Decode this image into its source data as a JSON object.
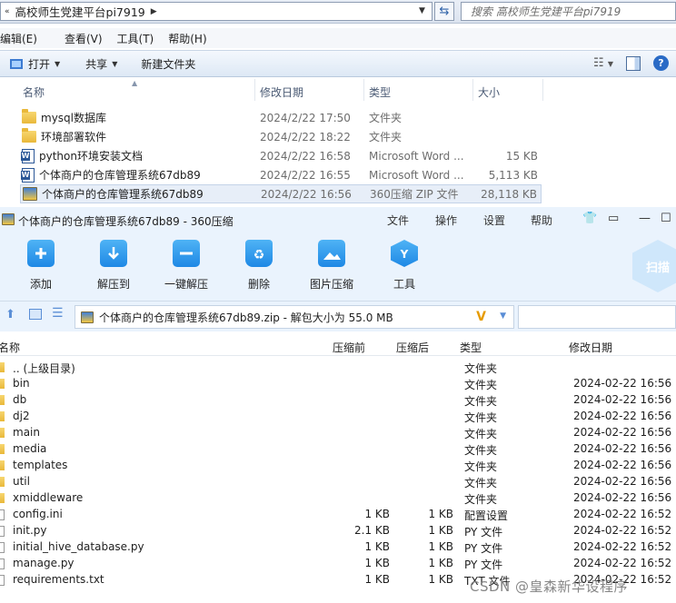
{
  "explorer": {
    "path_segment": "高校师生党建平台pi7919",
    "search_placeholder": "搜索 高校师生党建平台pi7919",
    "menu": [
      "编辑(E)",
      "查看(V)",
      "工具(T)",
      "帮助(H)"
    ],
    "toolbar": {
      "open": "打开",
      "share": "共享",
      "new_folder": "新建文件夹"
    },
    "columns": {
      "name": "名称",
      "date": "修改日期",
      "type": "类型",
      "size": "大小"
    },
    "files": [
      {
        "name": "mysql数据库",
        "date": "2024/2/22 17:50",
        "type": "文件夹",
        "size": "",
        "icon": "folder-icon"
      },
      {
        "name": "环境部署软件",
        "date": "2024/2/22 18:22",
        "type": "文件夹",
        "size": "",
        "icon": "folder-icon"
      },
      {
        "name": "python环境安装文档",
        "date": "2024/2/22 16:58",
        "type": "Microsoft Word ...",
        "size": "15 KB",
        "icon": "word-icon"
      },
      {
        "name": "个体商户的仓库管理系统67db89",
        "date": "2024/2/22 16:55",
        "type": "Microsoft Word ...",
        "size": "5,113 KB",
        "icon": "word-icon"
      },
      {
        "name": "个体商户的仓库管理系统67db89",
        "date": "2024/2/22 16:56",
        "type": "360压缩 ZIP 文件",
        "size": "28,118 KB",
        "icon": "zip-icon",
        "selected": true
      }
    ]
  },
  "zip": {
    "title": "个体商户的仓库管理系统67db89 - 360压缩",
    "menu": [
      "文件",
      "操作",
      "设置",
      "帮助"
    ],
    "ribbon": [
      "添加",
      "解压到",
      "一键解压",
      "删除",
      "图片压缩",
      "工具"
    ],
    "scan_label": "扫描",
    "path_text": "个体商户的仓库管理系统67db89.zip - 解包大小为 55.0 MB",
    "columns": {
      "name": "名称",
      "orig": "压缩前",
      "comp": "压缩后",
      "type": "类型",
      "date": "修改日期"
    },
    "rows": [
      {
        "name": ".. (上级目录)",
        "orig": "",
        "comp": "",
        "type": "文件夹",
        "date": "",
        "kind": "folder"
      },
      {
        "name": "bin",
        "orig": "",
        "comp": "",
        "type": "文件夹",
        "date": "2024-02-22 16:56",
        "kind": "folder"
      },
      {
        "name": "db",
        "orig": "",
        "comp": "",
        "type": "文件夹",
        "date": "2024-02-22 16:56",
        "kind": "folder"
      },
      {
        "name": "dj2",
        "orig": "",
        "comp": "",
        "type": "文件夹",
        "date": "2024-02-22 16:56",
        "kind": "folder"
      },
      {
        "name": "main",
        "orig": "",
        "comp": "",
        "type": "文件夹",
        "date": "2024-02-22 16:56",
        "kind": "folder"
      },
      {
        "name": "media",
        "orig": "",
        "comp": "",
        "type": "文件夹",
        "date": "2024-02-22 16:56",
        "kind": "folder"
      },
      {
        "name": "templates",
        "orig": "",
        "comp": "",
        "type": "文件夹",
        "date": "2024-02-22 16:56",
        "kind": "folder"
      },
      {
        "name": "util",
        "orig": "",
        "comp": "",
        "type": "文件夹",
        "date": "2024-02-22 16:56",
        "kind": "folder"
      },
      {
        "name": "xmiddleware",
        "orig": "",
        "comp": "",
        "type": "文件夹",
        "date": "2024-02-22 16:56",
        "kind": "folder"
      },
      {
        "name": "config.ini",
        "orig": "1 KB",
        "comp": "1 KB",
        "type": "配置设置",
        "date": "2024-02-22 16:52",
        "kind": "file"
      },
      {
        "name": "init.py",
        "orig": "2.1 KB",
        "comp": "1 KB",
        "type": "PY 文件",
        "date": "2024-02-22 16:52",
        "kind": "file"
      },
      {
        "name": "initial_hive_database.py",
        "orig": "1 KB",
        "comp": "1 KB",
        "type": "PY 文件",
        "date": "2024-02-22 16:52",
        "kind": "file"
      },
      {
        "name": "manage.py",
        "orig": "1 KB",
        "comp": "1 KB",
        "type": "PY 文件",
        "date": "2024-02-22 16:52",
        "kind": "file"
      },
      {
        "name": "requirements.txt",
        "orig": "1 KB",
        "comp": "1 KB",
        "type": "TXT 文件",
        "date": "2024-02-22 16:52",
        "kind": "file"
      }
    ]
  },
  "watermark": "CSDN @皇森新华设程序"
}
